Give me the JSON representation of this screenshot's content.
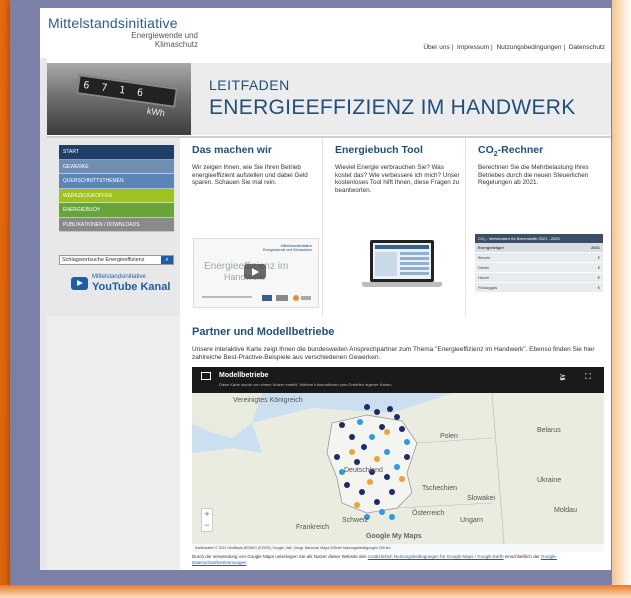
{
  "header": {
    "logo_main": "Mittelstandsinitiative",
    "logo_sub_1": "Energiewende und",
    "logo_sub_2": "Klimaschutz",
    "links": [
      "Über uns",
      "Impressum",
      "Nutzungsbedingungen",
      "Datenschutz"
    ]
  },
  "banner": {
    "meter_digits": "6 7 1 6",
    "meter_unit": "kWh",
    "eyebrow": "LEITFADEN",
    "title": "ENERGIEEFFIZIENZ IM HANDWERK"
  },
  "sidebar": {
    "items": [
      {
        "label": "START",
        "color": "#1f3f6a"
      },
      {
        "label": "GEWERKE",
        "color": "#6f8fb0"
      },
      {
        "label": "QUERSCHNITTSTHEMEN",
        "color": "#5a85b5"
      },
      {
        "label": "WERKZEUGKOFFER",
        "color": "#9ec21e"
      },
      {
        "label": "ENERGIEBUCH",
        "color": "#69a43a"
      },
      {
        "label": "PUBLIKATIONEN / DOWNLOADS",
        "color": "#8a8a8a"
      }
    ],
    "search_value": "Schlagwortsuche Energieeffizienz",
    "search_icon": "search-icon",
    "youtube_small": "Mittelstandsinitiative",
    "youtube_big": "YouTube Kanal"
  },
  "features": [
    {
      "title": "Das machen wir",
      "text": "Wir zeigen Ihnen, wie Sie Ihren Betrieb energieeffizient aufstellen und dabei Geld sparen. Schauen Sie mal rein."
    },
    {
      "title": "Energiebuch Tool",
      "text": "Wieviel Energie verbrauchen Sie? Was kostet das? Wie verbessere ich mich? Unser kostenloses Tool hilft Ihnen, diese Fragen zu beantworten."
    },
    {
      "title": "CO2-Rechner",
      "text": "Berechnen Sie die Mehrbelastung Ihres Betriebes durch die neuen Steuerlichen Regelungen ab 2021."
    }
  ],
  "video": {
    "small": "Mittelstandsinitiative Energiewende und Klimaschutz",
    "title_1": "Energieeffizienz im",
    "title_2": "Handwerk"
  },
  "co2_table": {
    "head": "CO₂ - Mehrkosten für Brennstoffe  2021 - 2025",
    "col1": "Energieträger",
    "col2": "2021",
    "rows": [
      {
        "name": "Benzin",
        "val": "€"
      },
      {
        "name": "Diesel",
        "val": "€"
      },
      {
        "name": "Heizöl",
        "val": "€"
      },
      {
        "name": "Flüssiggas",
        "val": "€"
      }
    ]
  },
  "partner": {
    "title": "Partner und Modellbetriebe",
    "intro": "Unsere interaktive Karte zeigt Ihnen die bundesweiten Ansprechpartner zum Thema \"Energieeffizienz im Handwerk\". Ebenso finden Sie hier zahlreiche Best-Practive-Beispiele aus verschiedenen Gewerken.",
    "map_title": "Modellbetriebe",
    "map_note": "Diese Karte wurde von einem Nutzer erstellt. Weitere Informationen zum Erstellen eigener Karten.",
    "map_labels": {
      "uk": "Vereinigtes Königreich",
      "germany": "Deutschland",
      "poland": "Polen",
      "belarus": "Belarus",
      "france": "Frankreich",
      "czech": "Tschechien",
      "slovakia": "Slowakei",
      "ukraine": "Ukraine",
      "moldova": "Moldau",
      "austria": "Österreich",
      "hungary": "Ungarn",
      "switzerland": "Schweiz"
    },
    "google": "Google My Maps",
    "map_attribution": "Kartendaten © 2021 GeoBasis-DE/BKG (©2009), Google, Inst. Geogr. Nacional, Mapa GISrael   Nutzungsbedingungen   200 km",
    "footer_pre": "Durch die Verwendung von Google Maps unterliegen Sie als Nutzer dieser Website den",
    "footer_link1": "zusätzlichen Nutzungsbedingungen für Google Maps / Google Earth",
    "footer_mid": "einschließlich der",
    "footer_link2": "Google-Datenschutzbestimmungen"
  }
}
